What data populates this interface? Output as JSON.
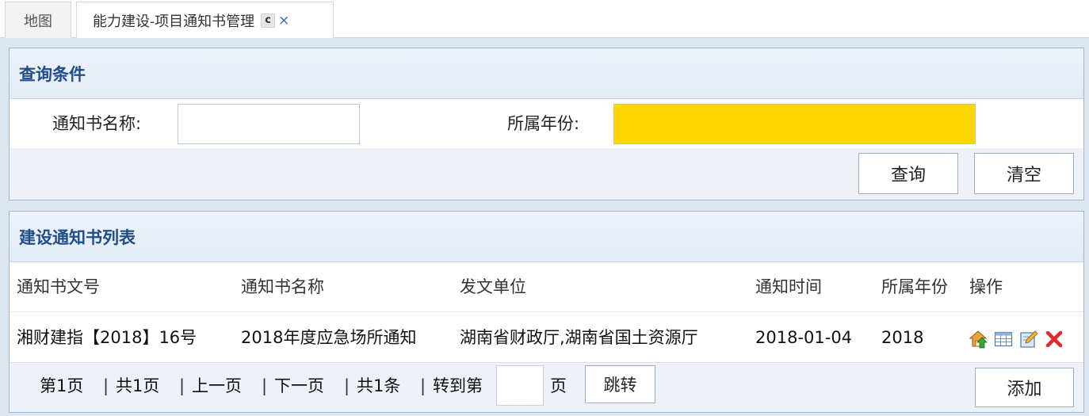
{
  "tabs": {
    "map": "地图",
    "active": "能力建设-项目通知书管理",
    "refresh_glyph": "c",
    "close_glyph": "×"
  },
  "query_panel": {
    "title": "查询条件",
    "name_label": "通知书名称:",
    "name_value": "",
    "year_label": "所属年份:",
    "year_value": "",
    "query_button": "查询",
    "clear_button": "清空",
    "year_field_color": "#ffd700"
  },
  "list_panel": {
    "title": "建设通知书列表",
    "columns": [
      "通知书文号",
      "通知书名称",
      "发文单位",
      "通知时间",
      "所属年份",
      "操作"
    ],
    "rows": [
      {
        "doc_no": "湘财建指【2018】16号",
        "name": "2018年度应急场所通知",
        "issuer": "湖南省财政厅,湖南省国土资源厅",
        "date": "2018-01-04",
        "year": "2018",
        "actions": [
          "home-upload-icon",
          "table-view-icon",
          "edit-icon",
          "delete-icon"
        ]
      }
    ]
  },
  "pager": {
    "current": "第1页",
    "total_pages": "共1页",
    "prev": "上一页",
    "next": "下一页",
    "total_items": "共1条",
    "goto_prefix": "转到第",
    "goto_suffix": "页",
    "goto_value": "",
    "separator": "|",
    "jump_button": "跳转",
    "add_button": "添加"
  },
  "colors": {
    "accent": "#1e4d8a",
    "panel_border": "#9fb6d1",
    "band": "#dde6f1"
  }
}
